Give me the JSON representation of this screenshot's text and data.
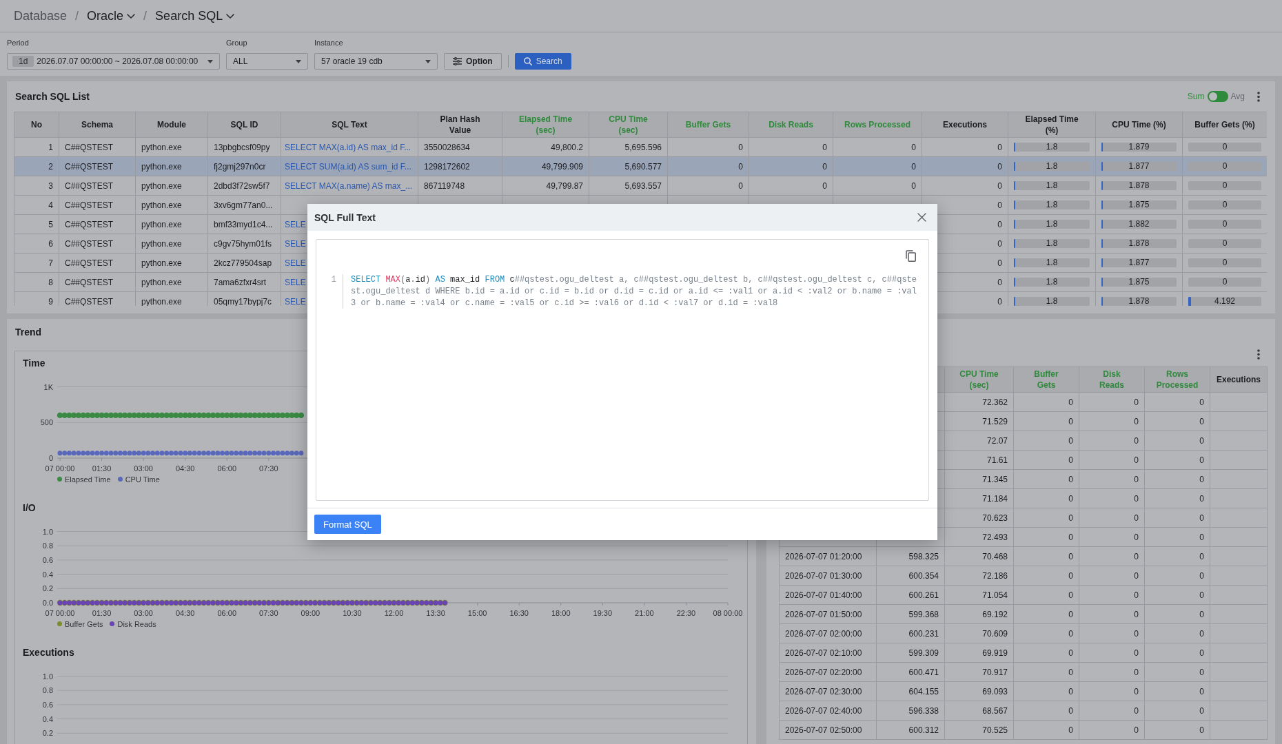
{
  "breadcrumb": {
    "items": [
      {
        "label": "Database",
        "muted": true,
        "dropdown": false
      },
      {
        "label": "Oracle",
        "muted": false,
        "dropdown": true
      },
      {
        "label": "Search SQL",
        "muted": false,
        "dropdown": true
      }
    ],
    "separators": [
      "/",
      "/"
    ]
  },
  "filters": {
    "period": {
      "label": "Period",
      "badge": "1d",
      "value": "2026.07.07 00:00:00 ~ 2026.07.08 00:00:00"
    },
    "group": {
      "label": "Group",
      "value": "ALL"
    },
    "instance": {
      "label": "Instance",
      "value": "57 oracle 19 cdb"
    },
    "option_button": "Option",
    "search_button": "Search"
  },
  "sql_list": {
    "title": "Search SQL List",
    "mode_toggle": [
      {
        "label": "Sum",
        "selected": true
      },
      {
        "label": "Avg",
        "selected": false
      }
    ],
    "columns": [
      {
        "label": "No",
        "kind": "number",
        "highlighted": false
      },
      {
        "label": "Schema",
        "kind": "text",
        "highlighted": false
      },
      {
        "label": "Module",
        "kind": "text",
        "highlighted": false
      },
      {
        "label": "SQL ID",
        "kind": "text",
        "highlighted": false
      },
      {
        "label": "SQL Text",
        "kind": "link",
        "highlighted": false
      },
      {
        "label": "Plan Hash Value",
        "kind": "text",
        "highlighted": false
      },
      {
        "label": "Elapsed Time (sec)",
        "kind": "number",
        "highlighted": true
      },
      {
        "label": "CPU Time (sec)",
        "kind": "number",
        "highlighted": true
      },
      {
        "label": "Buffer Gets",
        "kind": "number",
        "highlighted": true
      },
      {
        "label": "Disk Reads",
        "kind": "number",
        "highlighted": true
      },
      {
        "label": "Rows Processed",
        "kind": "number",
        "highlighted": true
      },
      {
        "label": "Executions",
        "kind": "number",
        "highlighted": false
      },
      {
        "label": "Elapsed Time (%)",
        "kind": "bar",
        "highlighted": false
      },
      {
        "label": "CPU Time (%)",
        "kind": "bar",
        "highlighted": false
      },
      {
        "label": "Buffer Gets (%)",
        "kind": "bar",
        "highlighted": false
      }
    ],
    "rows": [
      {
        "selected": false,
        "no": "1",
        "schema": "C##QSTEST",
        "module": "python.exe",
        "sql_id": "13pbgbcsf09py",
        "sql_text": "SELECT MAX(a.id) AS max_id F...",
        "plan_hash_value": "3550028634",
        "elapsed_time_sec": "49,800.2",
        "cpu_time_sec": "5,695.596",
        "buffer_gets": "0",
        "disk_reads": "0",
        "rows_processed": "0",
        "executions": "0",
        "elapsed_time_pct": {
          "value": "1.8",
          "level": 0.018
        },
        "cpu_time_pct": {
          "value": "1.879",
          "level": 0.01879
        },
        "buffer_gets_pct": {
          "value": "0",
          "level": 0
        }
      },
      {
        "selected": true,
        "no": "2",
        "schema": "C##QSTEST",
        "module": "python.exe",
        "sql_id": "fj2gmj297n0cr",
        "sql_text": "SELECT SUM(a.id) AS sum_id F...",
        "plan_hash_value": "1298172602",
        "elapsed_time_sec": "49,799.909",
        "cpu_time_sec": "5,690.577",
        "buffer_gets": "0",
        "disk_reads": "0",
        "rows_processed": "0",
        "executions": "0",
        "elapsed_time_pct": {
          "value": "1.8",
          "level": 0.018
        },
        "cpu_time_pct": {
          "value": "1.877",
          "level": 0.01877
        },
        "buffer_gets_pct": {
          "value": "0",
          "level": 0
        }
      },
      {
        "selected": false,
        "no": "3",
        "schema": "C##QSTEST",
        "module": "python.exe",
        "sql_id": "2dbd3f72sw5f7",
        "sql_text": "SELECT MAX(a.name) AS max_...",
        "plan_hash_value": "867119748",
        "elapsed_time_sec": "49,799.87",
        "cpu_time_sec": "5,693.557",
        "buffer_gets": "0",
        "disk_reads": "0",
        "rows_processed": "0",
        "executions": "0",
        "elapsed_time_pct": {
          "value": "1.8",
          "level": 0.018
        },
        "cpu_time_pct": {
          "value": "1.878",
          "level": 0.01878
        },
        "buffer_gets_pct": {
          "value": "0",
          "level": 0
        }
      },
      {
        "selected": false,
        "no": "4",
        "schema": "C##QSTEST",
        "module": "python.exe",
        "sql_id": "3xv6gm77an0...",
        "executions": "0",
        "elapsed_time_pct": {
          "value": "1.8",
          "level": 0.018
        },
        "cpu_time_pct": {
          "value": "1.875",
          "level": 0.01875
        },
        "buffer_gets_pct": {
          "value": "0",
          "level": 0
        }
      },
      {
        "selected": false,
        "no": "5",
        "schema": "C##QSTEST",
        "module": "python.exe",
        "sql_id": "bmf33myd1c4...",
        "sql_text": "SELE",
        "executions": "0",
        "elapsed_time_pct": {
          "value": "1.8",
          "level": 0.018
        },
        "cpu_time_pct": {
          "value": "1.882",
          "level": 0.01882
        },
        "buffer_gets_pct": {
          "value": "0",
          "level": 0
        }
      },
      {
        "selected": false,
        "no": "6",
        "schema": "C##QSTEST",
        "module": "python.exe",
        "sql_id": "c9gv75hym01fs",
        "sql_text": "SELE",
        "executions": "0",
        "elapsed_time_pct": {
          "value": "1.8",
          "level": 0.018
        },
        "cpu_time_pct": {
          "value": "1.878",
          "level": 0.01878
        },
        "buffer_gets_pct": {
          "value": "0",
          "level": 0
        }
      },
      {
        "selected": false,
        "no": "7",
        "schema": "C##QSTEST",
        "module": "python.exe",
        "sql_id": "2kcz779504sap",
        "sql_text": "SELE",
        "executions": "0",
        "elapsed_time_pct": {
          "value": "1.8",
          "level": 0.018
        },
        "cpu_time_pct": {
          "value": "1.877",
          "level": 0.01877
        },
        "buffer_gets_pct": {
          "value": "0",
          "level": 0
        }
      },
      {
        "selected": false,
        "no": "8",
        "schema": "C##QSTEST",
        "module": "python.exe",
        "sql_id": "7ama6zfxr4srt",
        "sql_text": "SELE",
        "executions": "0",
        "elapsed_time_pct": {
          "value": "1.8",
          "level": 0.018
        },
        "cpu_time_pct": {
          "value": "1.875",
          "level": 0.01875
        },
        "buffer_gets_pct": {
          "value": "0",
          "level": 0
        }
      },
      {
        "selected": false,
        "no": "9",
        "schema": "C##QSTEST",
        "module": "python.exe",
        "sql_id": "05qmy17bypj7c",
        "sql_text": "SELE",
        "executions": "0",
        "elapsed_time_pct": {
          "value": "1.8",
          "level": 0.018
        },
        "cpu_time_pct": {
          "value": "1.878",
          "level": 0.01878
        },
        "buffer_gets_pct": {
          "value": "4.192",
          "level": 0.04192
        }
      }
    ]
  },
  "trend": {
    "title": "Trend",
    "charts": [
      {
        "chart_data": {
          "type": "scatter",
          "title": "Time",
          "grid": true,
          "xlim": [
            0,
            1440
          ],
          "ylim": [
            0,
            1000
          ],
          "xticks": [
            {
              "value": 0,
              "label": "07 00:00"
            },
            {
              "value": 90,
              "label": "01:30"
            },
            {
              "value": 180,
              "label": "03:00"
            },
            {
              "value": 270,
              "label": "04:30"
            },
            {
              "value": 360,
              "label": "06:00"
            },
            {
              "value": 450,
              "label": "07:30"
            }
          ],
          "yticks": [
            {
              "value": 0,
              "label": "0"
            },
            {
              "value": 500,
              "label": "500"
            },
            {
              "value": 1000,
              "label": "1K"
            }
          ],
          "x": [
            0,
            10,
            20,
            30,
            40,
            50,
            60,
            70,
            80,
            90,
            100,
            110,
            120,
            130,
            140,
            150,
            160,
            170,
            180,
            190,
            200,
            210,
            220,
            230,
            240,
            250,
            260,
            270,
            280,
            290,
            300,
            310,
            320,
            330,
            340,
            350,
            360,
            370,
            380,
            390,
            400,
            410,
            420,
            430,
            440,
            450,
            460,
            470,
            480,
            490,
            500,
            510,
            520
          ],
          "series": [
            {
              "name": "Elapsed Time",
              "color": "#3a8a43",
              "values": [
                600,
                600,
                600,
                600,
                600,
                600,
                600,
                600,
                600,
                600,
                600,
                600,
                600,
                600,
                600,
                600,
                600,
                600,
                600,
                600,
                600,
                600,
                600,
                600,
                600,
                600,
                600,
                600,
                600,
                600,
                600,
                600,
                600,
                600,
                600,
                600,
                600,
                600,
                600,
                600,
                600,
                600,
                600,
                600,
                600,
                600,
                600,
                600,
                600,
                600,
                600,
                600,
                600
              ]
            },
            {
              "name": "CPU Time",
              "color": "#5a68bb",
              "values": [
                70,
                70,
                70,
                70,
                70,
                70,
                70,
                70,
                70,
                70,
                70,
                70,
                70,
                70,
                70,
                70,
                70,
                70,
                70,
                70,
                70,
                70,
                70,
                70,
                70,
                70,
                70,
                70,
                70,
                70,
                70,
                70,
                70,
                70,
                70,
                70,
                70,
                70,
                70,
                70,
                70,
                70,
                70,
                70,
                70,
                70,
                70,
                70,
                70,
                70,
                70,
                70,
                70
              ]
            }
          ]
        }
      },
      {
        "chart_data": {
          "type": "scatter",
          "title": "I/O",
          "grid": true,
          "xlim": [
            0,
            1440
          ],
          "ylim": [
            0,
            1
          ],
          "xticks": [
            {
              "value": 0,
              "label": "07 00:00"
            },
            {
              "value": 90,
              "label": "01:30"
            },
            {
              "value": 180,
              "label": "03:00"
            },
            {
              "value": 270,
              "label": "04:30"
            },
            {
              "value": 360,
              "label": "06:00"
            },
            {
              "value": 450,
              "label": "07:30"
            },
            {
              "value": 540,
              "label": "09:00"
            },
            {
              "value": 630,
              "label": "10:30"
            },
            {
              "value": 720,
              "label": "12:00"
            },
            {
              "value": 810,
              "label": "13:30"
            },
            {
              "value": 900,
              "label": "15:00"
            },
            {
              "value": 990,
              "label": "16:30"
            },
            {
              "value": 1080,
              "label": "18:00"
            },
            {
              "value": 1170,
              "label": "19:30"
            },
            {
              "value": 1260,
              "label": "21:00"
            },
            {
              "value": 1350,
              "label": "22:30"
            },
            {
              "value": 1440,
              "label": "08 00:00"
            }
          ],
          "yticks": [
            {
              "value": 0,
              "label": "0.0"
            },
            {
              "value": 0.2,
              "label": "0.2"
            },
            {
              "value": 0.4,
              "label": "0.4"
            },
            {
              "value": 0.6,
              "label": "0.6"
            },
            {
              "value": 0.8,
              "label": "0.8"
            },
            {
              "value": 1,
              "label": "1.0"
            }
          ],
          "x": [
            0,
            10,
            20,
            30,
            40,
            50,
            60,
            70,
            80,
            90,
            100,
            110,
            120,
            130,
            140,
            150,
            160,
            170,
            180,
            190,
            200,
            210,
            220,
            230,
            240,
            250,
            260,
            270,
            280,
            290,
            300,
            310,
            320,
            330,
            340,
            350,
            360,
            370,
            380,
            390,
            400,
            410,
            420,
            430,
            440,
            450,
            460,
            470,
            480,
            490,
            500,
            510,
            520,
            530,
            540,
            550,
            560,
            570,
            580,
            590,
            600,
            610,
            620,
            630,
            640,
            650,
            660,
            670,
            680,
            690,
            700,
            710,
            720,
            730,
            740,
            750,
            760,
            770,
            780,
            790,
            800,
            810,
            820,
            830
          ],
          "series": [
            {
              "name": "Buffer Gets",
              "color": "#7d8a29",
              "values": [
                0,
                0,
                0,
                0,
                0,
                0,
                0,
                0,
                0,
                0,
                0,
                0,
                0,
                0,
                0,
                0,
                0,
                0,
                0,
                0,
                0,
                0,
                0,
                0,
                0,
                0,
                0,
                0,
                0,
                0,
                0,
                0,
                0,
                0,
                0,
                0,
                0,
                0,
                0,
                0,
                0,
                0,
                0,
                0,
                0,
                0,
                0,
                0,
                0,
                0,
                0,
                0,
                0,
                0,
                0,
                0,
                0,
                0,
                0,
                0,
                0,
                0,
                0,
                0,
                0,
                0,
                0,
                0,
                0,
                0,
                0,
                0,
                0,
                0,
                0,
                0,
                0,
                0,
                0,
                0,
                0,
                0,
                0,
                0
              ]
            },
            {
              "name": "Disk Reads",
              "color": "#6a44b2",
              "values": [
                0,
                0,
                0,
                0,
                0,
                0,
                0,
                0,
                0,
                0,
                0,
                0,
                0,
                0,
                0,
                0,
                0,
                0,
                0,
                0,
                0,
                0,
                0,
                0,
                0,
                0,
                0,
                0,
                0,
                0,
                0,
                0,
                0,
                0,
                0,
                0,
                0,
                0,
                0,
                0,
                0,
                0,
                0,
                0,
                0,
                0,
                0,
                0,
                0,
                0,
                0,
                0,
                0,
                0,
                0,
                0,
                0,
                0,
                0,
                0,
                0,
                0,
                0,
                0,
                0,
                0,
                0,
                0,
                0,
                0,
                0,
                0,
                0,
                0,
                0,
                0,
                0,
                0,
                0,
                0,
                0,
                0,
                0,
                0
              ]
            }
          ]
        }
      },
      {
        "title": "Executions",
        "axis_labels": [
          "1.0",
          "0.8",
          "0.6",
          "0.4",
          "0.2"
        ]
      }
    ]
  },
  "trend_table": {
    "columns": [
      {
        "label": "CPU Time (sec)",
        "highlighted": true
      },
      {
        "label": "Buffer Gets",
        "highlighted": true
      },
      {
        "label": "Disk Reads",
        "highlighted": true
      },
      {
        "label": "Rows Processed",
        "highlighted": true
      },
      {
        "label": "Executions",
        "highlighted": false
      }
    ],
    "rows": [
      {
        "cpu_time_sec": "72.362",
        "buffer_gets": "0",
        "disk_reads": "0",
        "rows_processed": "0"
      },
      {
        "cpu_time_sec": "71.529",
        "buffer_gets": "0",
        "disk_reads": "0",
        "rows_processed": "0"
      },
      {
        "cpu_time_sec": "72.07",
        "buffer_gets": "0",
        "disk_reads": "0",
        "rows_processed": "0"
      },
      {
        "cpu_time_sec": "71.61",
        "buffer_gets": "0",
        "disk_reads": "0",
        "rows_processed": "0"
      },
      {
        "cpu_time_sec": "71.345",
        "buffer_gets": "0",
        "disk_reads": "0",
        "rows_processed": "0"
      },
      {
        "cpu_time_sec": "71.184",
        "buffer_gets": "0",
        "disk_reads": "0",
        "rows_processed": "0"
      },
      {
        "cpu_time_sec": "70.623",
        "buffer_gets": "0",
        "disk_reads": "0",
        "rows_processed": "0"
      },
      {
        "cpu_time_sec": "72.493",
        "buffer_gets": "0",
        "disk_reads": "0",
        "rows_processed": "0"
      },
      {
        "column_1": "2026-07-07 01:20:00",
        "column_2": "598.325",
        "cpu_time_sec": "70.468",
        "buffer_gets": "0",
        "disk_reads": "0",
        "rows_processed": "0"
      },
      {
        "column_1": "2026-07-07 01:30:00",
        "column_2": "600.354",
        "cpu_time_sec": "72.186",
        "buffer_gets": "0",
        "disk_reads": "0",
        "rows_processed": "0"
      },
      {
        "column_1": "2026-07-07 01:40:00",
        "column_2": "600.261",
        "cpu_time_sec": "71.054",
        "buffer_gets": "0",
        "disk_reads": "0",
        "rows_processed": "0"
      },
      {
        "column_1": "2026-07-07 01:50:00",
        "column_2": "599.368",
        "cpu_time_sec": "69.192",
        "buffer_gets": "0",
        "disk_reads": "0",
        "rows_processed": "0"
      },
      {
        "column_1": "2026-07-07 02:00:00",
        "column_2": "600.231",
        "cpu_time_sec": "70.609",
        "buffer_gets": "0",
        "disk_reads": "0",
        "rows_processed": "0"
      },
      {
        "column_1": "2026-07-07 02:10:00",
        "column_2": "599.309",
        "cpu_time_sec": "69.919",
        "buffer_gets": "0",
        "disk_reads": "0",
        "rows_processed": "0"
      },
      {
        "column_1": "2026-07-07 02:20:00",
        "column_2": "600.471",
        "cpu_time_sec": "70.917",
        "buffer_gets": "0",
        "disk_reads": "0",
        "rows_processed": "0"
      },
      {
        "column_1": "2026-07-07 02:30:00",
        "column_2": "604.155",
        "cpu_time_sec": "69.093",
        "buffer_gets": "0",
        "disk_reads": "0",
        "rows_processed": "0"
      },
      {
        "column_1": "2026-07-07 02:40:00",
        "column_2": "596.338",
        "cpu_time_sec": "68.567",
        "buffer_gets": "0",
        "disk_reads": "0",
        "rows_processed": "0"
      },
      {
        "column_1": "2026-07-07 02:50:00",
        "column_2": "600.312",
        "cpu_time_sec": "70.525",
        "buffer_gets": "0",
        "disk_reads": "0",
        "rows_processed": "0"
      }
    ]
  },
  "dialog": {
    "title": "SQL Full Text",
    "code_lines": [
      {
        "number": "1",
        "tokens": [
          {
            "text": "SELECT ",
            "kind": "keyword"
          },
          {
            "text": "MAX",
            "kind": "function"
          },
          {
            "text": "(",
            "kind": "punctuation"
          },
          {
            "text": "a",
            "kind": "identifier"
          },
          {
            "text": ".",
            "kind": "punctuation"
          },
          {
            "text": "id",
            "kind": "identifier"
          },
          {
            "text": ") ",
            "kind": "punctuation"
          },
          {
            "text": "AS ",
            "kind": "keyword"
          },
          {
            "text": "max_id ",
            "kind": "identifier"
          },
          {
            "text": "FROM ",
            "kind": "keyword"
          },
          {
            "text": "c",
            "kind": "identifier"
          },
          {
            "text": "##qstest.ogu_deltest a, c##qstest.ogu_deltest b, c##qstest.ogu_deltest c, c##qstest.ogu_deltest d WHERE b.id = a.id or c.id = b.id or d.id = c.id or a.id <= :val1 or a.id < :val2 or b.name = :val3 or b.name = :val4 or c.name = :val5 or c.id >= :val6 or d.id < :val7 or d.id = :val8",
            "kind": "comment"
          }
        ]
      }
    ],
    "button": "Format SQL"
  }
}
